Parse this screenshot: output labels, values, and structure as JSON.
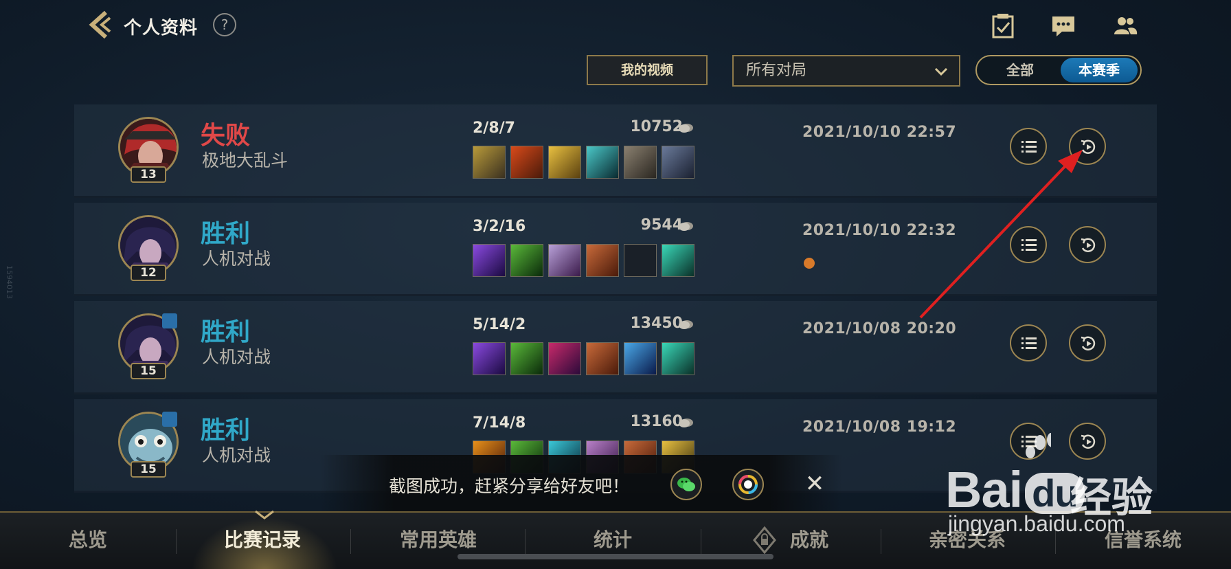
{
  "header": {
    "title": "个人资料",
    "help": "?"
  },
  "filters": {
    "my_videos": "我的视频",
    "game_filter": "所有对局",
    "season_toggle": {
      "all": "全部",
      "season": "本赛季",
      "selected": "本赛季"
    }
  },
  "matches": [
    {
      "result": "失败",
      "result_type": "loss",
      "mode": "极地大乱斗",
      "level": "13",
      "kda": "2/8/7",
      "gold": "10752",
      "date": "2021/10/10 22:57",
      "party": false
    },
    {
      "result": "胜利",
      "result_type": "win",
      "mode": "人机对战",
      "level": "12",
      "kda": "3/2/16",
      "gold": "9544",
      "date": "2021/10/10 22:32",
      "party": false
    },
    {
      "result": "胜利",
      "result_type": "win",
      "mode": "人机对战",
      "level": "15",
      "kda": "5/14/2",
      "gold": "13450",
      "date": "2021/10/08 20:20",
      "party": true
    },
    {
      "result": "胜利",
      "result_type": "win",
      "mode": "人机对战",
      "level": "15",
      "kda": "7/14/8",
      "gold": "13160",
      "date": "2021/10/08 19:12",
      "party": true
    }
  ],
  "toast": {
    "text": "截图成功，赶紧分享给好友吧！",
    "close": "✕"
  },
  "tabs": [
    {
      "label": "总览"
    },
    {
      "label": "比赛记录",
      "active": true
    },
    {
      "label": "常用英雄"
    },
    {
      "label": "统计"
    },
    {
      "label": "成就"
    },
    {
      "label": "亲密关系"
    },
    {
      "label": "信誉系统"
    }
  ],
  "watermark": {
    "brand": "Bai",
    "brand_du": "du",
    "jingyan": "经验",
    "url": "jingyan.baidu.com"
  },
  "side_text": "1594013",
  "colors": {
    "loss": "#e04848",
    "win": "#30a8c8",
    "gold_border": "#9c8652",
    "accent_blue": "#1d7ab8",
    "annotation": "#e02020"
  }
}
